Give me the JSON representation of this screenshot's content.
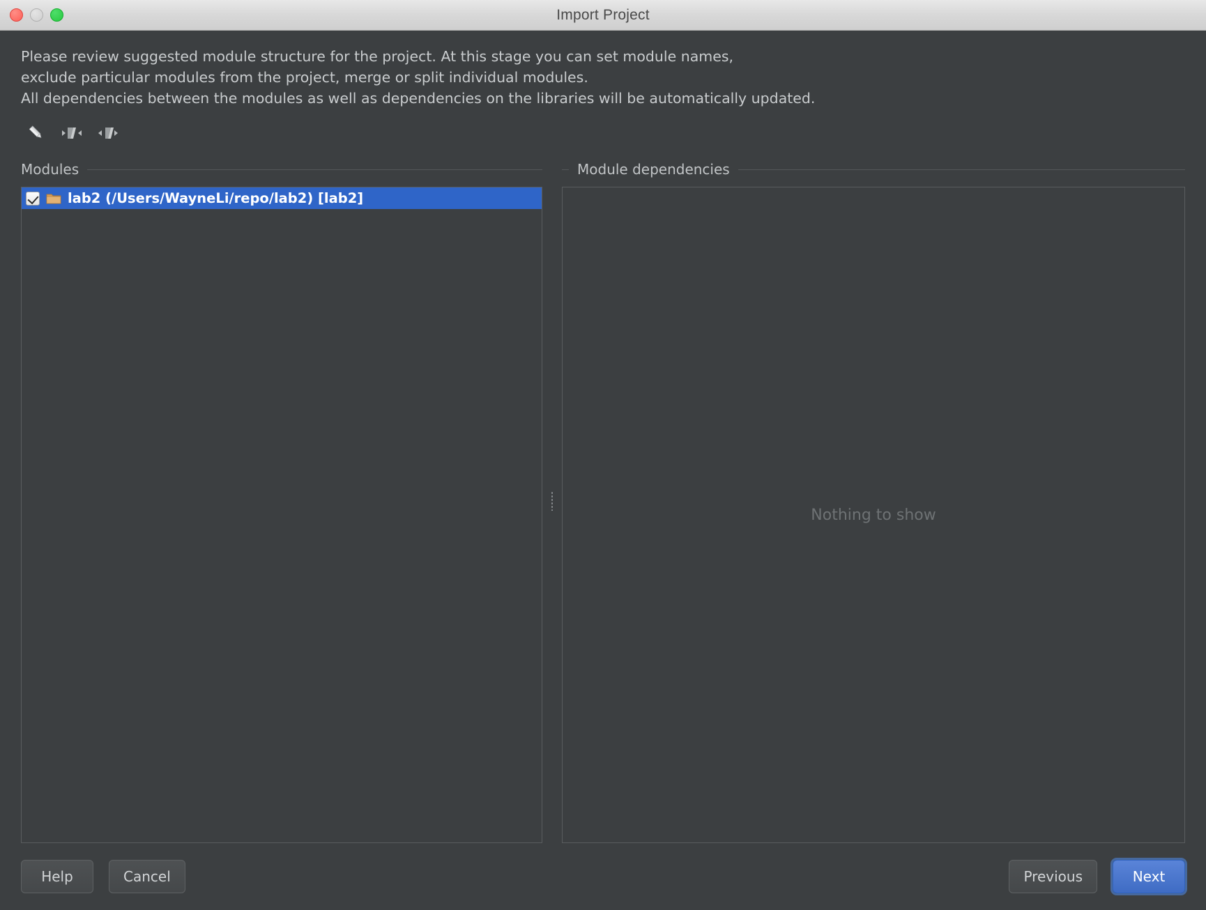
{
  "window": {
    "title": "Import Project",
    "traffic_lights": [
      "close",
      "minimize",
      "zoom"
    ]
  },
  "description": {
    "line1": "Please review suggested module structure for the project. At this stage you can set module names,",
    "line2": "exclude particular modules from the project, merge or split individual modules.",
    "line3": "All dependencies between the modules as well as dependencies on the libraries will be automatically updated."
  },
  "toolbar": {
    "items": [
      {
        "name": "edit-icon",
        "tooltip": "Rename module"
      },
      {
        "name": "merge-modules-icon",
        "tooltip": "Merge modules"
      },
      {
        "name": "split-module-icon",
        "tooltip": "Split module"
      }
    ]
  },
  "modules_panel": {
    "title": "Modules",
    "rows": [
      {
        "checked": true,
        "icon": "folder-icon",
        "label": "lab2 (/Users/WayneLi/repo/lab2) [lab2]",
        "selected": true
      }
    ]
  },
  "dependencies_panel": {
    "title": "Module dependencies",
    "empty_message": "Nothing to show"
  },
  "footer": {
    "help_label": "Help",
    "cancel_label": "Cancel",
    "previous_label": "Previous",
    "next_label": "Next"
  },
  "colors": {
    "selection_blue": "#2f65c8",
    "default_button_blue": "#3f6cc4",
    "background": "#3c3f41",
    "folder_orange": "#d9a05b"
  }
}
